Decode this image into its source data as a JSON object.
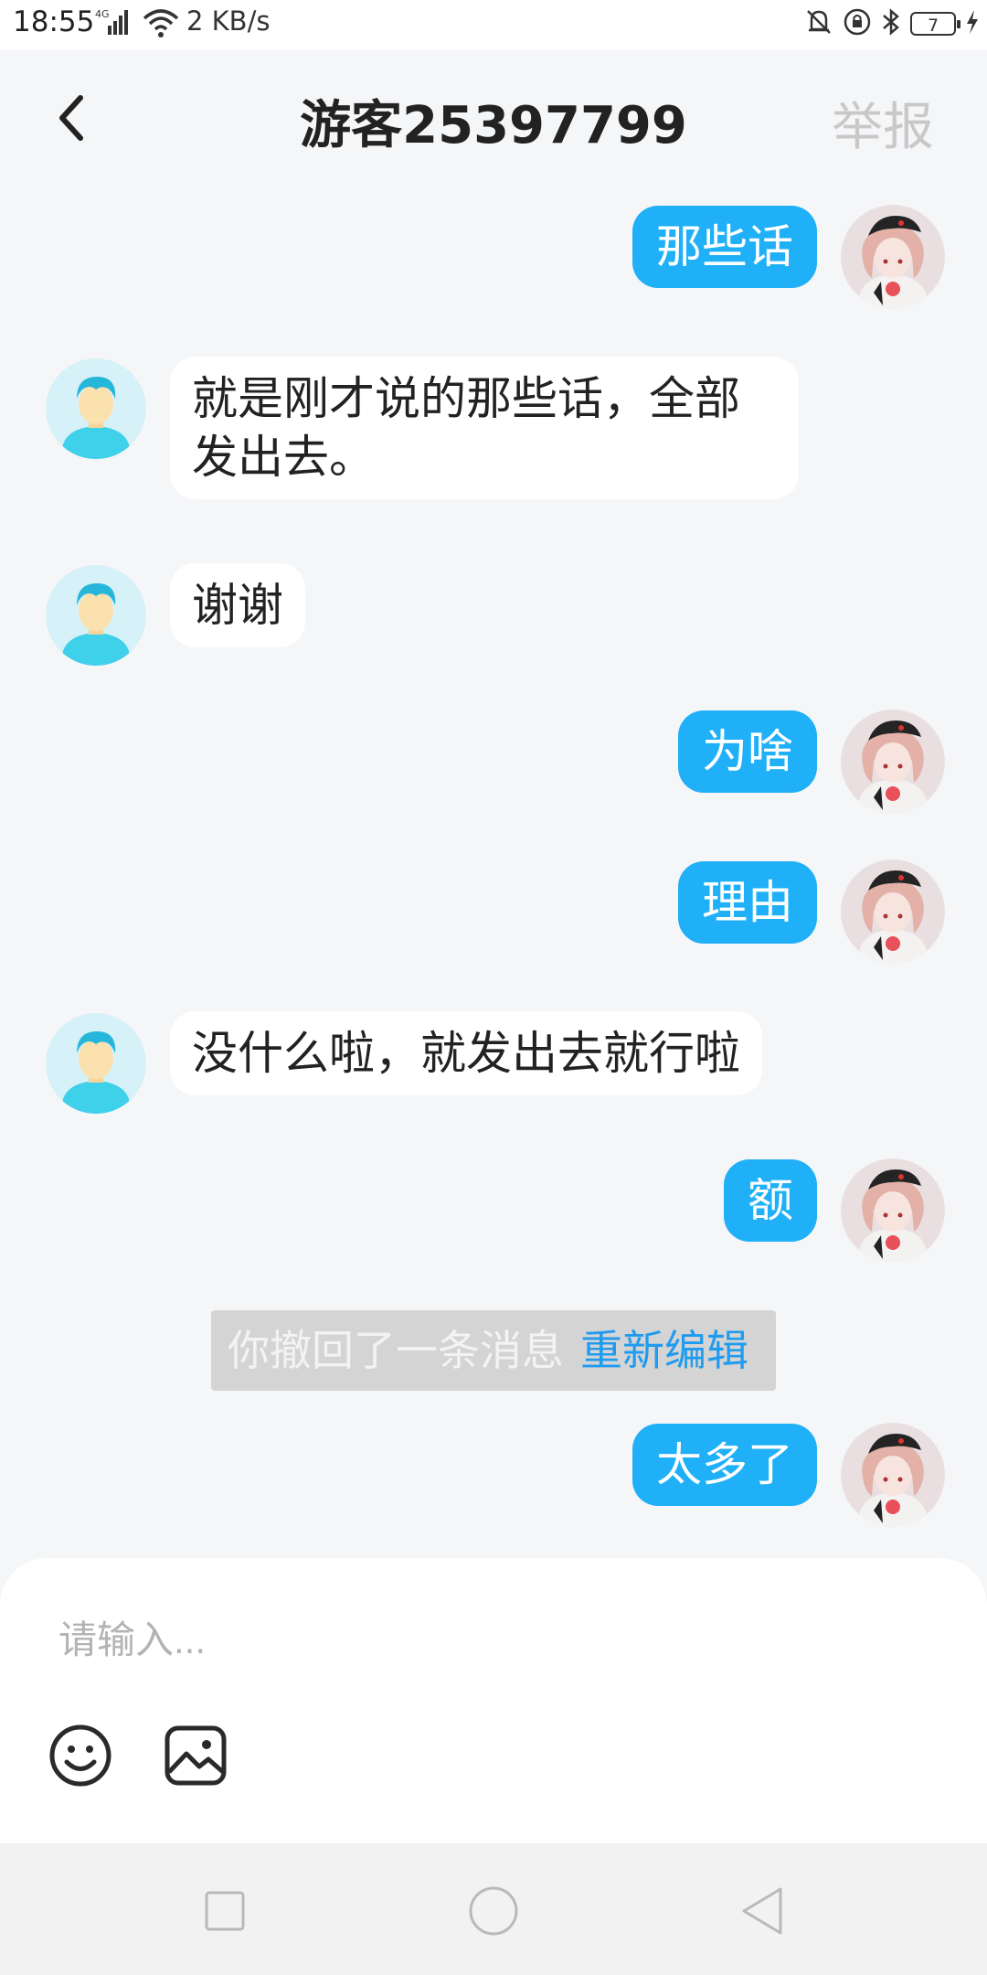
{
  "status_bar": {
    "time": "18:55",
    "network": "4G",
    "speed": "2 KB/s",
    "battery": "7",
    "icons": [
      "signal-icon",
      "wifi-icon",
      "mute-icon",
      "rotation-lock-icon",
      "bluetooth-icon",
      "battery-icon",
      "charging-icon"
    ]
  },
  "header": {
    "title": "游客25397799",
    "report_label": "举报",
    "back_icon": "chevron-left-icon"
  },
  "messages": [
    {
      "from": "me",
      "text": "那些话"
    },
    {
      "from": "other",
      "text": "就是刚才说的那些话，全部发出去。"
    },
    {
      "from": "other",
      "text": "谢谢"
    },
    {
      "from": "me",
      "text": "为啥"
    },
    {
      "from": "me",
      "text": "理由"
    },
    {
      "from": "other",
      "text": "没什么啦，就发出去就行啦"
    },
    {
      "from": "me",
      "text": "额"
    },
    {
      "from": "me",
      "text": "太多了"
    }
  ],
  "recall_notice": {
    "text": "你撤回了一条消息",
    "action": "重新编辑"
  },
  "input": {
    "placeholder": "请输入..."
  },
  "toolbar": {
    "icons": [
      "emoji-icon",
      "image-icon"
    ]
  },
  "nav_bar": {
    "icons": [
      "recents-square-icon",
      "home-circle-icon",
      "back-triangle-icon"
    ]
  },
  "colors": {
    "my_bubble": "#1fb0f7",
    "other_bubble": "#ffffff",
    "background": "#f5f6f8",
    "link": "#1f9bf0"
  }
}
